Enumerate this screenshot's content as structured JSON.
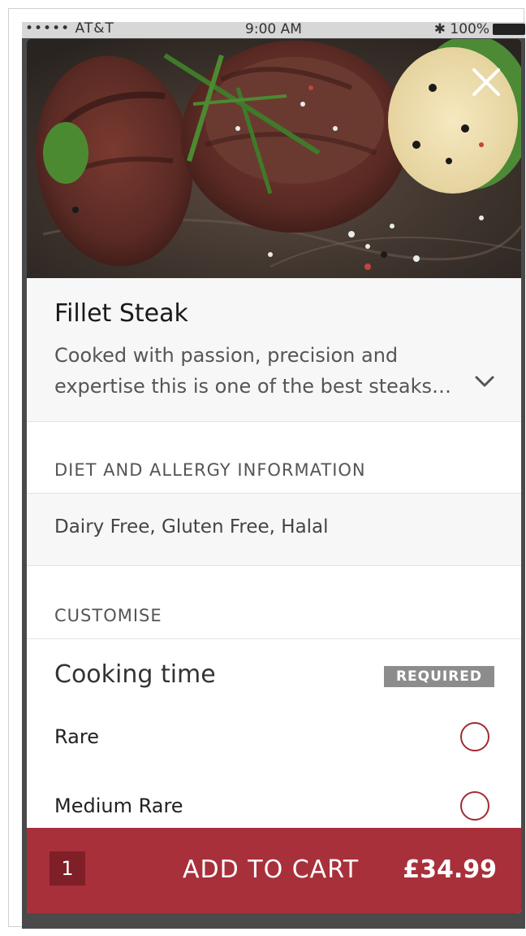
{
  "status_bar": {
    "carrier": "••••• AT&T",
    "time": "9:00 AM",
    "battery": "✱ 100%"
  },
  "item": {
    "title": "Fillet Steak",
    "description_line1": "Cooked with passion, precision and",
    "description_line2": "expertise this is one of the best steaks…"
  },
  "diet": {
    "heading": "DIET AND ALLERGY INFORMATION",
    "value": "Dairy Free, Gluten Free, Halal"
  },
  "customise": {
    "heading": "CUSTOMISE",
    "option_group_title": "Cooking time",
    "required_label": "REQUIRED",
    "options": [
      {
        "label": "Rare"
      },
      {
        "label": "Medium Rare"
      }
    ]
  },
  "cart": {
    "quantity": "1",
    "button_label": "ADD TO CART",
    "price": "£34.99"
  },
  "colors": {
    "accent": "#a8303a",
    "accent_dark": "#7f1f28",
    "badge": "#8c8c8c"
  }
}
